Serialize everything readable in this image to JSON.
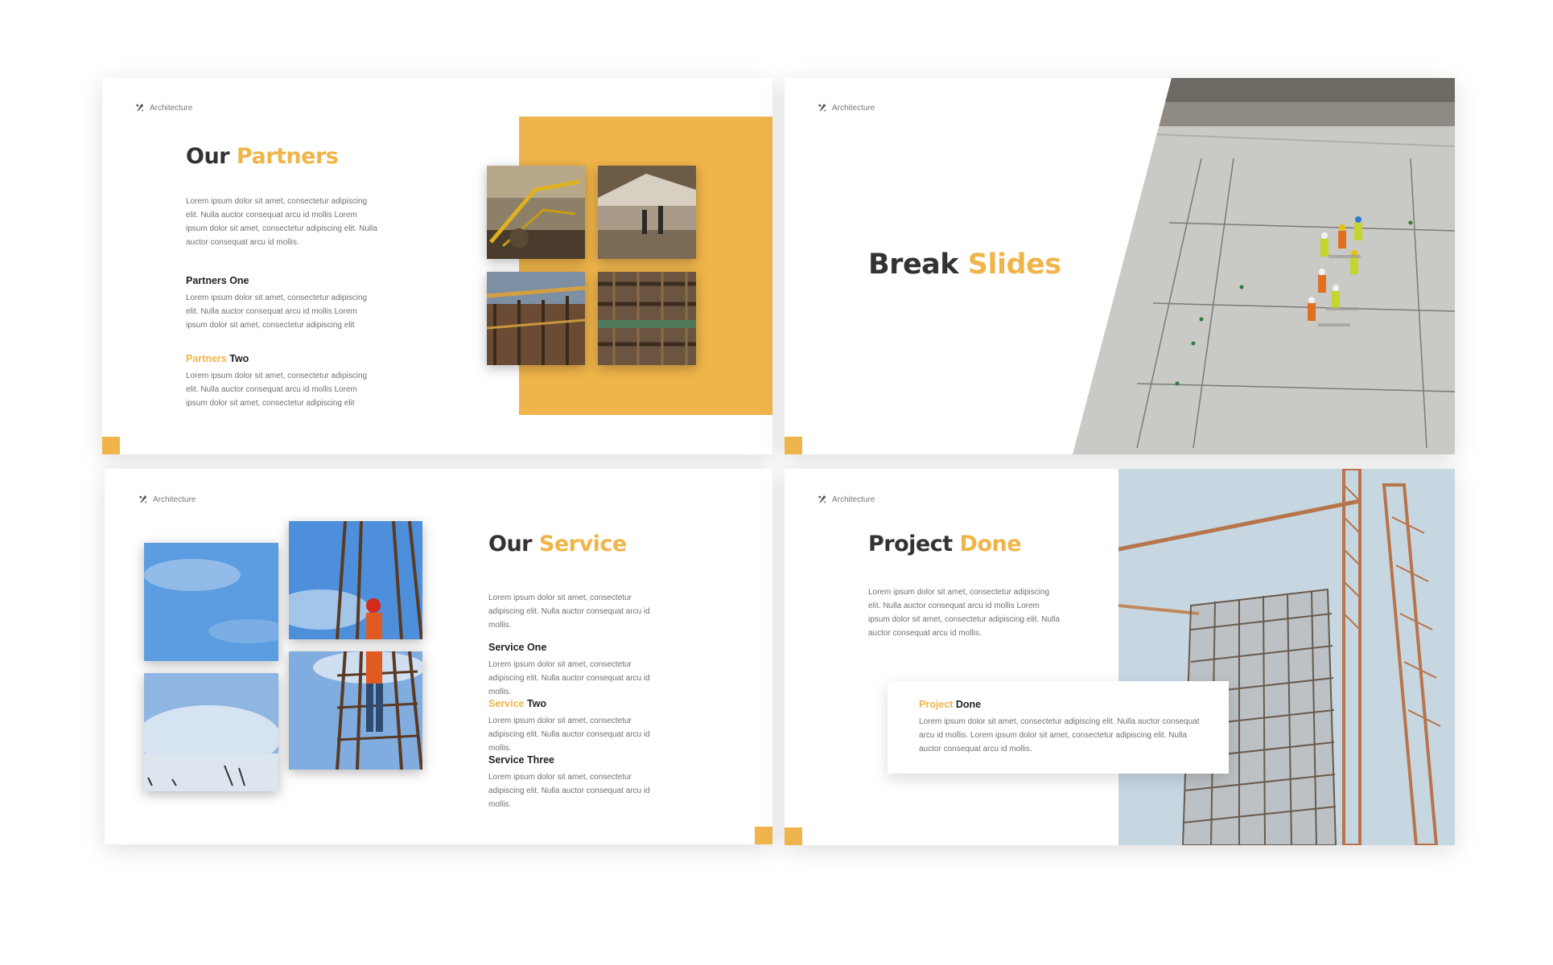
{
  "brand": "Architecture",
  "colors": {
    "accent": "#F0B54A",
    "title": "#333333",
    "body": "#707070"
  },
  "icons": {
    "brand": "tools-icon"
  },
  "slide1": {
    "title_part1": "Our",
    "title_part2": "Partners",
    "intro": "Lorem ipsum dolor sit amet, consectetur adipiscing elit. Nulla auctor consequat arcu id mollis Lorem ipsum dolor sit amet, consectetur adipiscing elit. Nulla auctor consequat arcu id mollis.",
    "item1_title": "Partners One",
    "item1_text": "Lorem ipsum dolor sit amet, consectetur adipiscing elit. Nulla auctor consequat arcu id mollis Lorem ipsum dolor sit amet, consectetur adipiscing elit",
    "item2_title_hl": "Partners",
    "item2_title_rest": " Two",
    "item2_text": "Lorem ipsum dolor sit amet, consectetur adipiscing elit. Nulla auctor consequat arcu id mollis Lorem ipsum dolor sit amet, consectetur adipiscing elit"
  },
  "slide2": {
    "title_part1": "Break",
    "title_part2": "Slides"
  },
  "slide3": {
    "title_part1": "Our",
    "title_part2": "Service",
    "intro": "Lorem ipsum dolor sit amet, consectetur adipiscing elit. Nulla auctor consequat arcu id mollis.",
    "item1_title": "Service One",
    "item1_text": "Lorem ipsum dolor sit amet, consectetur adipiscing elit. Nulla auctor consequat arcu id mollis.",
    "item2_title_hl": "Service",
    "item2_title_rest": " Two",
    "item2_text": "Lorem ipsum dolor sit amet, consectetur adipiscing elit. Nulla auctor consequat arcu id mollis.",
    "item3_title": "Service Three",
    "item3_text": "Lorem ipsum dolor sit amet, consectetur adipiscing elit. Nulla auctor consequat arcu id mollis."
  },
  "slide4": {
    "title_part1": "Project",
    "title_part2": "Done",
    "intro": "Lorem ipsum dolor sit amet, consectetur adipiscing elit. Nulla auctor consequat arcu id mollis Lorem ipsum dolor sit amet, consectetur adipiscing elit. Nulla auctor consequat arcu id mollis.",
    "card_title_hl": "Project",
    "card_title_rest": " Done",
    "card_text": "Lorem ipsum dolor sit amet, consectetur adipiscing elit. Nulla auctor consequat arcu id mollis. Lorem ipsum dolor sit amet, consectetur adipiscing elit. Nulla auctor consequat arcu id mollis."
  }
}
